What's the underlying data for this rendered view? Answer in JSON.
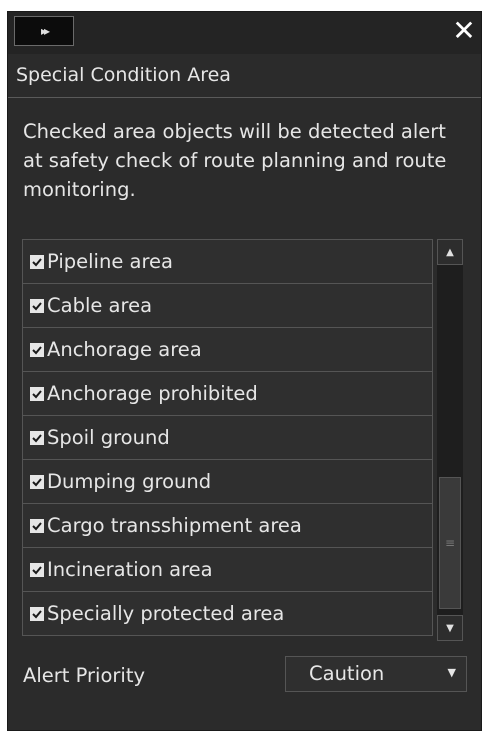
{
  "titlebar": {
    "expand_icon": "▸▸",
    "close_icon": "✕"
  },
  "header": {
    "title": "Special Condition Area"
  },
  "description": "Checked area objects will be detected alert at safety check of route planning and route monitoring.",
  "items": [
    {
      "label": "Pipeline area",
      "checked": true
    },
    {
      "label": "Cable area",
      "checked": true
    },
    {
      "label": "Anchorage area",
      "checked": true
    },
    {
      "label": "Anchorage prohibited",
      "checked": true
    },
    {
      "label": "Spoil ground",
      "checked": true
    },
    {
      "label": "Dumping ground",
      "checked": true
    },
    {
      "label": "Cargo transshipment area",
      "checked": true
    },
    {
      "label": "Incineration area",
      "checked": true
    },
    {
      "label": "Specially protected area",
      "checked": true
    }
  ],
  "scrollbar": {
    "up": "▲",
    "down": "▼",
    "thumb_grip": "≡"
  },
  "priority": {
    "label": "Alert Priority",
    "value": "Caution",
    "arrow": "▼"
  }
}
